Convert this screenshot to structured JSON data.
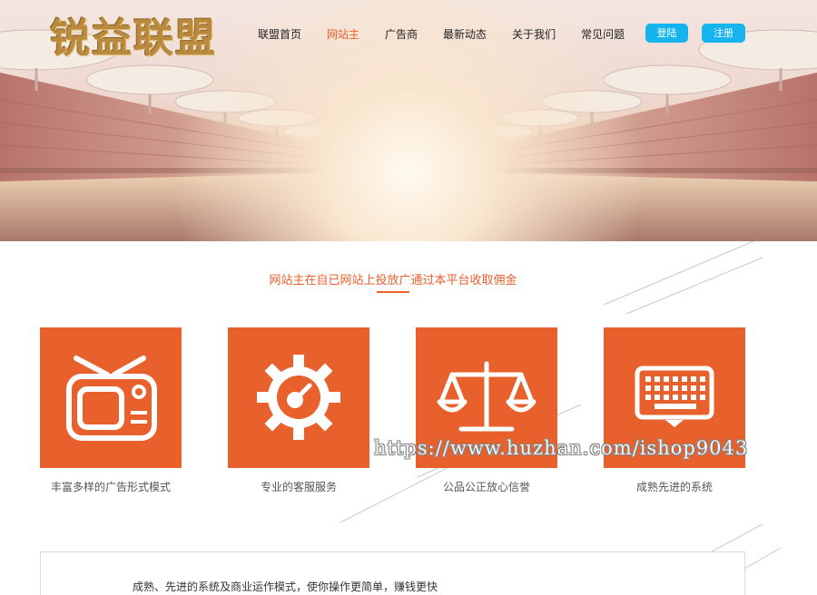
{
  "header": {
    "logo_text": "锐益联盟",
    "nav": [
      {
        "label": "联盟首页",
        "active": false
      },
      {
        "label": "网站主",
        "active": true
      },
      {
        "label": "广告商",
        "active": false
      },
      {
        "label": "最新动态",
        "active": false
      },
      {
        "label": "关于我们",
        "active": false
      },
      {
        "label": "常见问题",
        "active": false
      }
    ],
    "login_label": "登陆",
    "register_label": "注册"
  },
  "section": {
    "title": "网站主在自已网站上投放广通过本平台收取佣金"
  },
  "features": [
    {
      "icon": "tv-icon",
      "label": "丰富多样的广告形式模式"
    },
    {
      "icon": "gear-icon",
      "label": "专业的客服服务"
    },
    {
      "icon": "scale-icon",
      "label": "公品公正放心信誉"
    },
    {
      "icon": "keyboard-icon",
      "label": "成熟先进的系统"
    }
  ],
  "watermark": "https://www.huzhan.com/ishop9043",
  "bottom": {
    "text": "成熟、先进的系统及商业运作模式，使你操作更简单，赚钱更快"
  },
  "colors": {
    "accent": "#e8602c",
    "button": "#16b4ee",
    "logo": "#b98a3e"
  }
}
